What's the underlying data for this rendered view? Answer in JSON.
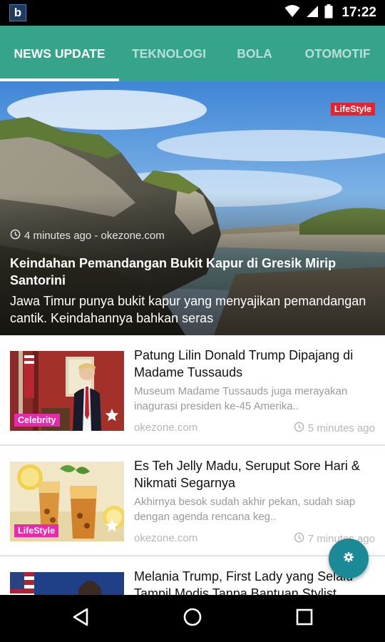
{
  "status_bar": {
    "app_letter": "b",
    "time": "17:22",
    "icons": [
      "wifi-icon",
      "signal-icon",
      "battery-icon"
    ]
  },
  "tabs": [
    {
      "label": "NEWS UPDATE",
      "active": true
    },
    {
      "label": "TEKNOLOGI",
      "active": false
    },
    {
      "label": "BOLA",
      "active": false
    },
    {
      "label": "OTOMOTIF",
      "active": false
    }
  ],
  "hero": {
    "category": "LifeStyle",
    "time_ago": "4 minutes ago",
    "source": "okezone.com",
    "meta": "4 minutes ago - okezone.com",
    "title": "Keindahan Pemandangan Bukit Kapur di Gresik Mirip Santorini",
    "description": "Jawa Timur punya bukit kapur yang menyajikan pemandangan cantik. Keindahannya bahkan seras"
  },
  "news": [
    {
      "title": "Patung Lilin Donald Trump Dipajang di Madame Tussauds",
      "description": "Museum Madame Tussauds juga merayakan inagurasi presiden ke-45 Amerika..",
      "source": "okezone.com",
      "time_ago": "5 minutes ago",
      "category": "Celebrity"
    },
    {
      "title": "Es Teh Jelly Madu, Seruput Sore Hari & Nikmati Segarnya",
      "description": "Akhirnya besok sudah akhir pekan, sudah siap dengan agenda rencana keg..",
      "source": "okezone.com",
      "time_ago": "7 minutes ago",
      "category": "LifeStyle"
    },
    {
      "title": "Melania Trump, First Lady yang Selalu Tampil Modis Tanpa Bantuan Stylist",
      "description": "",
      "source": "",
      "time_ago": "",
      "category": ""
    }
  ],
  "colors": {
    "tab_bar": "#35a48b",
    "hero_badge": "#e8212d",
    "category_badge": "#e52aae",
    "fab": "#1b8a97"
  },
  "nav_bar": [
    "back-icon",
    "home-icon",
    "recents-icon"
  ]
}
